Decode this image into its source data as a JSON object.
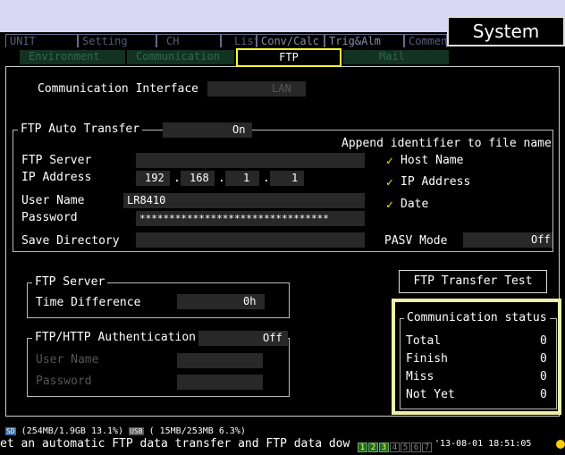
{
  "system_button": "System",
  "tabs_row1": [
    "UNIT",
    "Setting",
    "CH",
    "List",
    "Conv/Calc",
    "Trig&Alm",
    "Commen"
  ],
  "tabs_row2": {
    "environment": "Environment",
    "communication": "Communication",
    "ftp": "FTP",
    "mail": "Mail"
  },
  "comm_interface": {
    "label": "Communication Interface",
    "value": "LAN"
  },
  "ftp_auto": {
    "label": "FTP Auto Transfer",
    "value": "On"
  },
  "append": {
    "title": "Append identifier to file name",
    "host_name": "Host Name",
    "ip_address": "IP Address",
    "date": "Date",
    "check": "✓"
  },
  "ftp_server_label": "FTP Server",
  "ip_label": "IP Address",
  "ip_octets": [
    "192",
    "168",
    "1",
    "1"
  ],
  "ip_sep": ".",
  "user_name": {
    "label": "User Name",
    "value": "LR8410"
  },
  "password": {
    "label": "Password",
    "value": "********************************"
  },
  "save_dir": {
    "label": "Save Directory",
    "value": ""
  },
  "pasv": {
    "label": "PASV Mode",
    "value": "Off"
  },
  "ftp_test_button": "FTP Transfer Test",
  "server_group": {
    "title": "FTP Server",
    "time_diff_label": "Time Difference",
    "time_diff_value": "0h"
  },
  "auth_group": {
    "title": "FTP/HTTP Authentication",
    "value": "Off",
    "user_label": "User Name",
    "pass_label": "Password"
  },
  "status": {
    "title": "Communication status",
    "rows": [
      {
        "label": "Total",
        "value": "0"
      },
      {
        "label": "Finish",
        "value": "0"
      },
      {
        "label": "Miss",
        "value": "0"
      },
      {
        "label": "Not Yet",
        "value": "0"
      }
    ]
  },
  "footer": {
    "sd_badge": "SD",
    "sd_info": "(254MB/1.9GB 13.1%)",
    "usb_badge": "USB",
    "usb_info": "( 15MB/253MB  6.3%)",
    "help_text": "et an automatic FTP data transfer and FTP data dow",
    "unit_boxes": [
      "1",
      "2",
      "3",
      "4",
      "5",
      "6",
      "7"
    ],
    "unit_boxes_on": 3,
    "datetime": "'13-08-01 18:51:05"
  },
  "colors": {
    "highlight": "#ffff33",
    "status_border": "#eef0a8",
    "field": "#282828"
  }
}
